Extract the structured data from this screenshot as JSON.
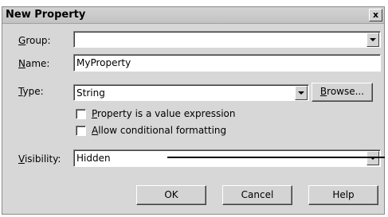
{
  "dialog": {
    "title": "New Property",
    "close_glyph": "x"
  },
  "group": {
    "label_u": "G",
    "label_rest": "roup:",
    "value": ""
  },
  "name": {
    "label_u": "N",
    "label_rest": "ame:",
    "value": "MyProperty"
  },
  "type": {
    "label_u": "T",
    "label_rest": "ype:",
    "value": "String",
    "browse_u": "B",
    "browse_rest": "rowse..."
  },
  "options": {
    "value_expression_u": "P",
    "value_expression_rest": "roperty is a value expression",
    "value_expression_checked": false,
    "conditional_u": "A",
    "conditional_rest": "llow conditional formatting",
    "conditional_checked": false
  },
  "visibility": {
    "label_u": "V",
    "label_rest": "isibility:",
    "value": "Hidden"
  },
  "buttons": {
    "ok": "OK",
    "cancel": "Cancel",
    "help": "Help"
  }
}
